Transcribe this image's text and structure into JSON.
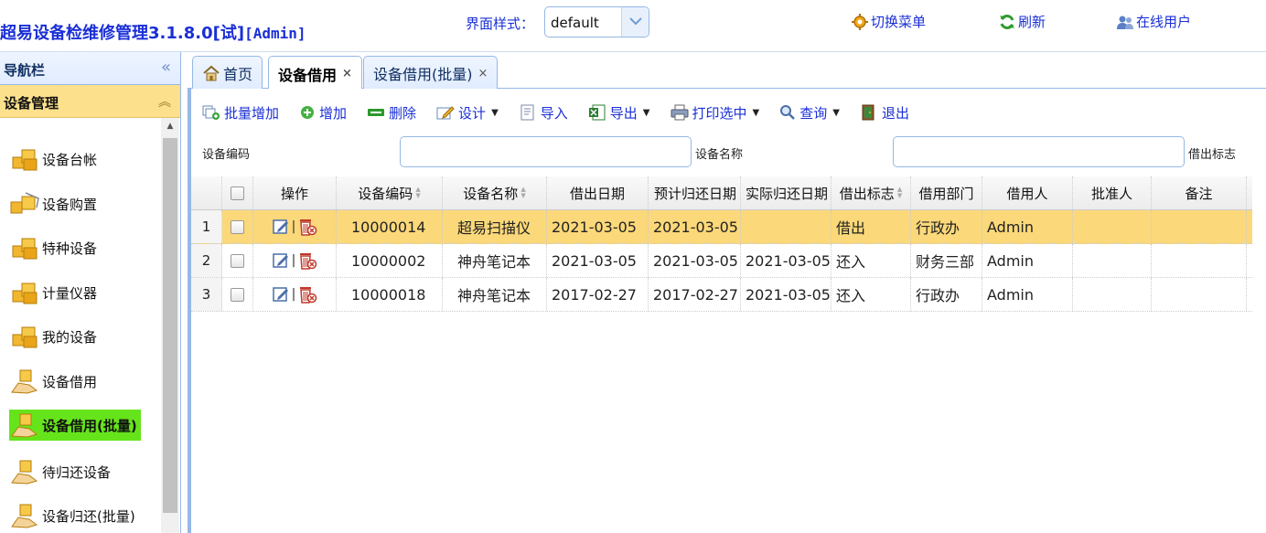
{
  "header": {
    "app_title": "超易设备检维修管理3.1.8.0[试]",
    "user_tag": "[Admin]",
    "style_label": "界面样式：",
    "style_value": "default",
    "switch_menu": "切换菜单",
    "refresh": "刷新",
    "online_users": "在线用户"
  },
  "sidebar": {
    "nav_title": "导航栏",
    "panel_title": "设备管理",
    "items": [
      {
        "label": "设备台帐"
      },
      {
        "label": "设备购置"
      },
      {
        "label": "特种设备"
      },
      {
        "label": "计量仪器"
      },
      {
        "label": "我的设备"
      },
      {
        "label": "设备借用"
      },
      {
        "label": "设备借用(批量)",
        "active": true
      },
      {
        "label": "待归还设备"
      },
      {
        "label": "设备归还(批量)"
      }
    ]
  },
  "tabs": [
    {
      "label": "首页"
    },
    {
      "label": "设备借用",
      "active": true,
      "close": "×"
    },
    {
      "label": "设备借用(批量)",
      "close": "×"
    }
  ],
  "toolbar": {
    "batch_add": "批量增加",
    "add": "增加",
    "delete": "删除",
    "design": "设计",
    "import": "导入",
    "export": "导出",
    "print_selected": "打印选中",
    "query": "查询",
    "exit": "退出"
  },
  "search": {
    "code_label": "设备编码",
    "code_value": "",
    "name_label": "设备名称",
    "name_value": "",
    "flag_label": "借出标志"
  },
  "table": {
    "headers": {
      "op": "操作",
      "code": "设备编码",
      "name": "设备名称",
      "borrow_date": "借出日期",
      "plan_return": "预计归还日期",
      "actual_return": "实际归还日期",
      "flag": "借出标志",
      "dept": "借用部门",
      "borrower": "借用人",
      "approver": "批准人",
      "remark": "备注"
    },
    "rows": [
      {
        "rn": "1",
        "code": "10000014",
        "name": "超易扫描仪",
        "borrow_date": "2021-03-05",
        "plan_return": "2021-03-05",
        "actual_return": "",
        "flag": "借出",
        "dept": "行政办",
        "borrower": "Admin",
        "approver": "",
        "remark": ""
      },
      {
        "rn": "2",
        "code": "10000002",
        "name": "神舟笔记本",
        "borrow_date": "2021-03-05",
        "plan_return": "2021-03-05",
        "actual_return": "2021-03-05",
        "flag": "还入",
        "dept": "财务三部",
        "borrower": "Admin",
        "approver": "",
        "remark": ""
      },
      {
        "rn": "3",
        "code": "10000018",
        "name": "神舟笔记本",
        "borrow_date": "2017-02-27",
        "plan_return": "2017-02-27",
        "actual_return": "2021-03-05",
        "flag": "还入",
        "dept": "行政办",
        "borrower": "Admin",
        "approver": "",
        "remark": ""
      }
    ]
  }
}
